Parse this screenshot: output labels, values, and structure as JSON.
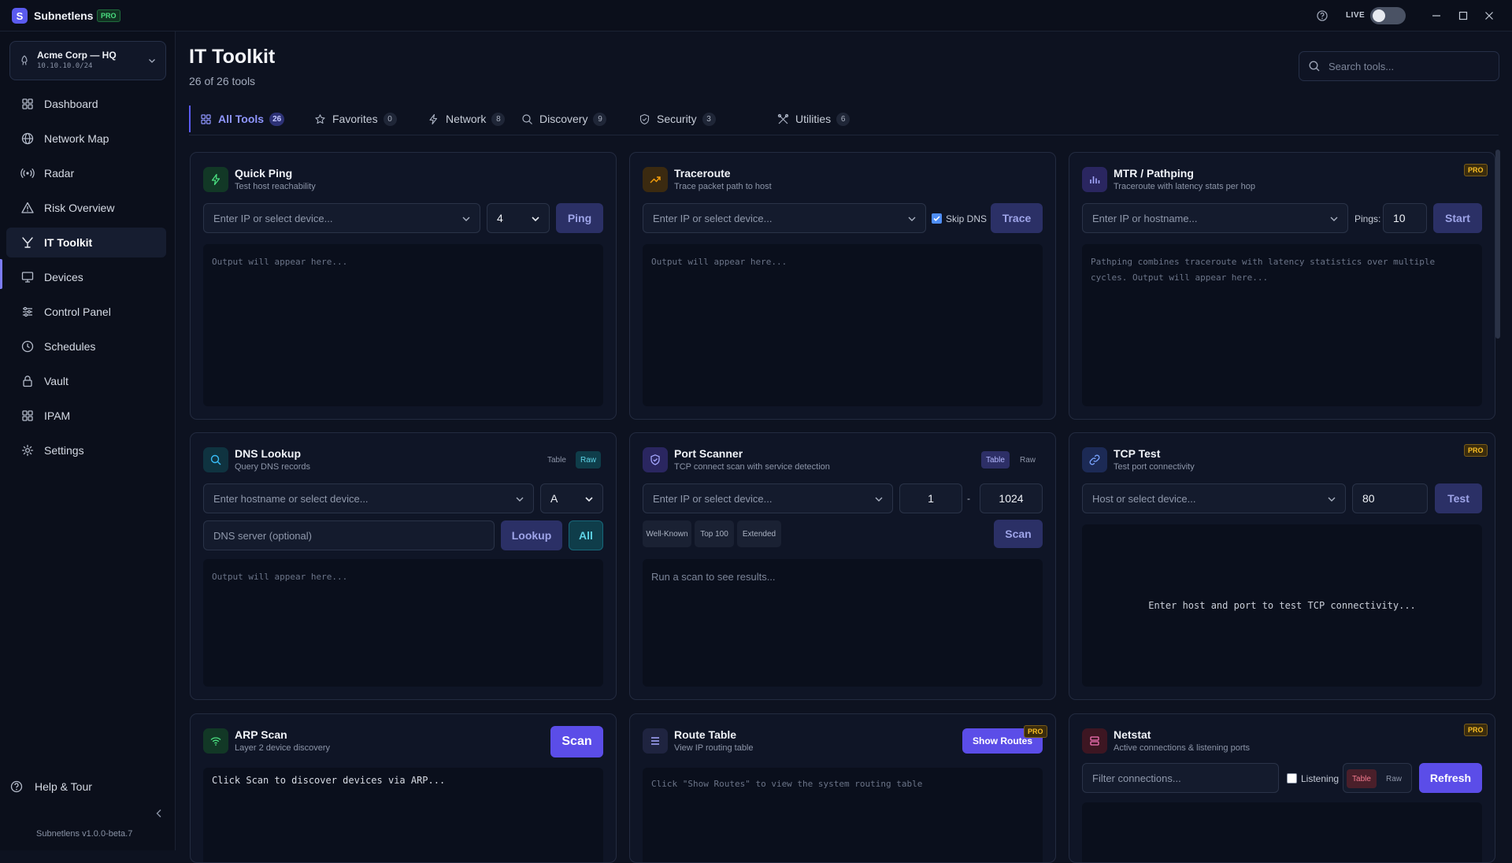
{
  "app": {
    "name": "Subnetlens",
    "badge": "PRO",
    "live_label": "LIVE"
  },
  "site": {
    "name": "Acme Corp — HQ",
    "subnet": "10.10.10.0/24"
  },
  "sidebar": {
    "items": [
      {
        "label": "Dashboard",
        "icon": "grid-icon"
      },
      {
        "label": "Network Map",
        "icon": "globe-icon"
      },
      {
        "label": "Radar",
        "icon": "radar-icon"
      },
      {
        "label": "Risk Overview",
        "icon": "warning-icon"
      },
      {
        "label": "IT Toolkit",
        "icon": "toolkit-icon",
        "active": true
      },
      {
        "label": "Devices",
        "icon": "monitor-icon"
      },
      {
        "label": "Control Panel",
        "icon": "sliders-icon"
      },
      {
        "label": "Schedules",
        "icon": "clock-icon"
      },
      {
        "label": "Vault",
        "icon": "lock-icon"
      },
      {
        "label": "IPAM",
        "icon": "grid-icon"
      },
      {
        "label": "Settings",
        "icon": "gear-icon"
      }
    ],
    "help": "Help & Tour",
    "version": "Subnetlens v1.0.0-beta.7"
  },
  "header": {
    "title": "IT Toolkit",
    "subtitle": "26 of 26 tools",
    "search_placeholder": "Search tools..."
  },
  "tabs": [
    {
      "label": "All Tools",
      "count": "26",
      "active": true
    },
    {
      "label": "Favorites",
      "count": "0"
    },
    {
      "label": "Network",
      "count": "8"
    },
    {
      "label": "Discovery",
      "count": "9"
    },
    {
      "label": "Security",
      "count": "3"
    },
    {
      "label": "Utilities",
      "count": "6"
    }
  ],
  "tools": {
    "ping": {
      "title": "Quick Ping",
      "subtitle": "Test host reachability",
      "target_placeholder": "Enter IP or select device...",
      "count": "4",
      "button": "Ping",
      "output": "Output will appear here..."
    },
    "traceroute": {
      "title": "Traceroute",
      "subtitle": "Trace packet path to host",
      "target_placeholder": "Enter IP or select device...",
      "skip_dns": "Skip DNS",
      "button": "Trace",
      "output": "Output will appear here..."
    },
    "mtr": {
      "title": "MTR / Pathping",
      "subtitle": "Traceroute with latency stats per hop",
      "badge": "PRO",
      "target_placeholder": "Enter IP or hostname...",
      "pings_label": "Pings:",
      "pings": "10",
      "button": "Start",
      "output": "Pathping combines traceroute with latency statistics over multiple cycles. Output will appear here..."
    },
    "dns": {
      "title": "DNS Lookup",
      "subtitle": "Query DNS records",
      "view_table": "Table",
      "view_raw": "Raw",
      "target_placeholder": "Enter hostname or select device...",
      "record_type": "A",
      "server_placeholder": "DNS server (optional)",
      "button": "Lookup",
      "all_button": "All",
      "output": "Output will appear here..."
    },
    "portscan": {
      "title": "Port Scanner",
      "subtitle": "TCP connect scan with service detection",
      "view_table": "Table",
      "view_raw": "Raw",
      "target_placeholder": "Enter IP or select device...",
      "port_from": "1",
      "dash": "-",
      "port_to": "1024",
      "presets": [
        "Well-Known",
        "Top 100",
        "Extended"
      ],
      "button": "Scan",
      "output": "Run a scan to see results..."
    },
    "tcp": {
      "title": "TCP Test",
      "subtitle": "Test port connectivity",
      "badge": "PRO",
      "target_placeholder": "Host or select device...",
      "port": "80",
      "button": "Test",
      "output": "Enter host and port to test TCP connectivity..."
    },
    "arp": {
      "title": "ARP Scan",
      "subtitle": "Layer 2 device discovery",
      "button": "Scan",
      "output": "Click Scan to discover devices via ARP..."
    },
    "routes": {
      "title": "Route Table",
      "subtitle": "View IP routing table",
      "badge": "PRO",
      "button": "Show Routes",
      "output": "Click \"Show Routes\" to view the system routing table"
    },
    "netstat": {
      "title": "Netstat",
      "subtitle": "Active connections & listening ports",
      "badge": "PRO",
      "filter_placeholder": "Filter connections...",
      "listening": "Listening",
      "view_table": "Table",
      "view_raw": "Raw",
      "button": "Refresh"
    }
  },
  "colors": {
    "accent": "#5b4de8",
    "background": "#0d1220",
    "card": "#0f1526",
    "pro": "#fbbf24"
  }
}
